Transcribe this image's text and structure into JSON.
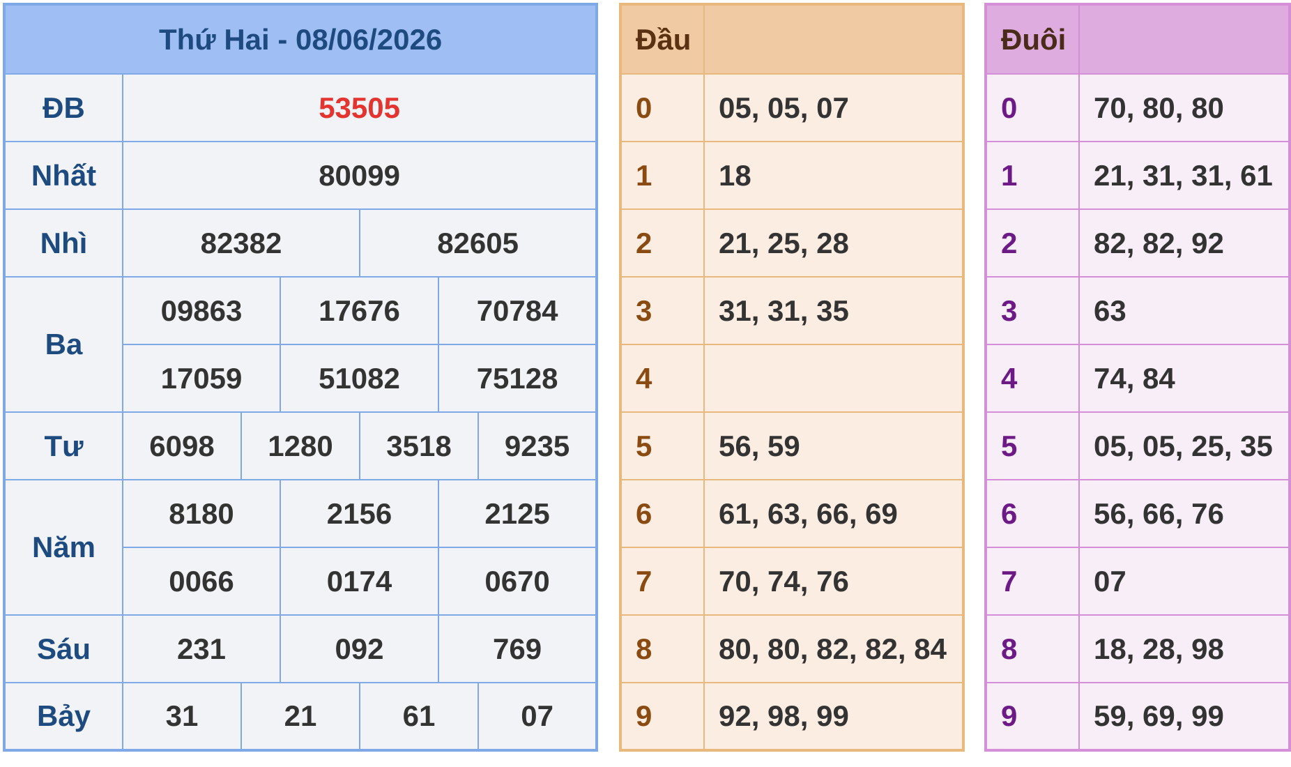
{
  "header": {
    "title": "Thứ Hai - 08/06/2026"
  },
  "colors": {
    "special": "#e3342f",
    "label": "#1d4b80",
    "header_bg": "#9fbff4"
  },
  "prizes": {
    "db": {
      "label": "ĐB",
      "values": [
        "53505"
      ]
    },
    "nhat": {
      "label": "Nhất",
      "values": [
        "80099"
      ]
    },
    "nhi": {
      "label": "Nhì",
      "values": [
        "82382",
        "82605"
      ]
    },
    "ba": {
      "label": "Ba",
      "values": [
        "09863",
        "17676",
        "70784",
        "17059",
        "51082",
        "75128"
      ]
    },
    "tu": {
      "label": "Tư",
      "values": [
        "6098",
        "1280",
        "3518",
        "9235"
      ]
    },
    "nam": {
      "label": "Năm",
      "values": [
        "8180",
        "2156",
        "2125",
        "0066",
        "0174",
        "0670"
      ]
    },
    "sau": {
      "label": "Sáu",
      "values": [
        "231",
        "092",
        "769"
      ]
    },
    "bay": {
      "label": "Bảy",
      "values": [
        "31",
        "21",
        "61",
        "07"
      ]
    }
  },
  "dau": {
    "title": "Đầu",
    "rows": [
      {
        "key": "0",
        "values": "05, 05, 07"
      },
      {
        "key": "1",
        "values": "18"
      },
      {
        "key": "2",
        "values": "21, 25, 28"
      },
      {
        "key": "3",
        "values": "31, 31, 35"
      },
      {
        "key": "4",
        "values": ""
      },
      {
        "key": "5",
        "values": "56, 59"
      },
      {
        "key": "6",
        "values": "61, 63, 66, 69"
      },
      {
        "key": "7",
        "values": "70, 74, 76"
      },
      {
        "key": "8",
        "values": "80, 80, 82, 82, 84"
      },
      {
        "key": "9",
        "values": "92, 98, 99"
      }
    ]
  },
  "duoi": {
    "title": "Đuôi",
    "rows": [
      {
        "key": "0",
        "values": "70, 80, 80"
      },
      {
        "key": "1",
        "values": "21, 31, 31, 61"
      },
      {
        "key": "2",
        "values": "82, 82, 92"
      },
      {
        "key": "3",
        "values": "63"
      },
      {
        "key": "4",
        "values": "74, 84"
      },
      {
        "key": "5",
        "values": "05, 05, 25, 35"
      },
      {
        "key": "6",
        "values": "56, 66, 76"
      },
      {
        "key": "7",
        "values": "07"
      },
      {
        "key": "8",
        "values": "18, 28, 98"
      },
      {
        "key": "9",
        "values": "59, 69, 99"
      }
    ]
  }
}
